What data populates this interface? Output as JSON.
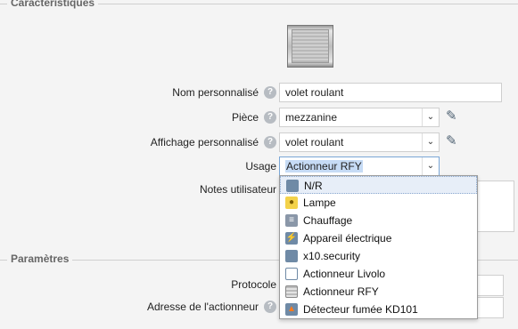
{
  "sections": {
    "characteristics": "Caractéristiques",
    "parameters": "Paramètres"
  },
  "fields": {
    "name_label": "Nom personnalisé",
    "name_value": "volet roulant",
    "room_label": "Pièce",
    "room_value": "mezzanine",
    "display_label": "Affichage personnalisé",
    "display_value": "volet roulant",
    "usage_label": "Usage",
    "usage_value": "Actionneur RFY",
    "notes_label": "Notes utilisateur",
    "protocol_label": "Protocole",
    "address_label": "Adresse de l'actionneur"
  },
  "help_glyph": "?",
  "dropdown": {
    "options": [
      {
        "label": "N/R",
        "icon": "generic-device-icon"
      },
      {
        "label": "Lampe",
        "icon": "lamp-icon"
      },
      {
        "label": "Chauffage",
        "icon": "heater-icon"
      },
      {
        "label": "Appareil électrique",
        "icon": "plug-icon"
      },
      {
        "label": "x10.security",
        "icon": "generic-device-icon"
      },
      {
        "label": "Actionneur Livolo",
        "icon": "switch-icon"
      },
      {
        "label": "Actionneur RFY",
        "icon": "shutter-icon"
      },
      {
        "label": "Détecteur fumée KD101",
        "icon": "fire-icon"
      }
    ]
  },
  "colors": {
    "accent": "#4f6273",
    "highlight": "#e7eef8"
  }
}
